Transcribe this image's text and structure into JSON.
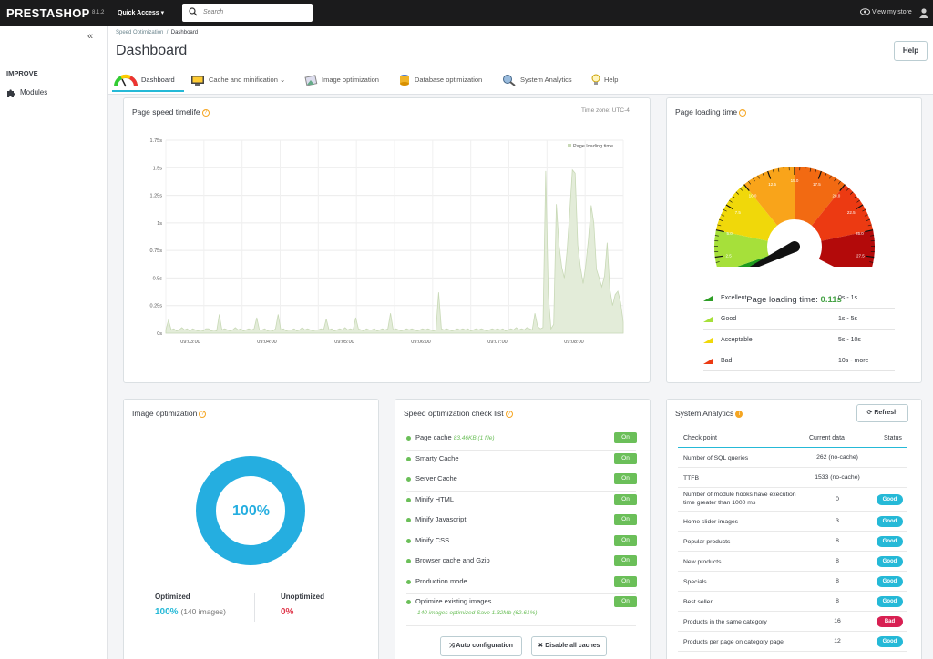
{
  "topbar": {
    "logo": "PRESTASHOP",
    "version": "8.1.2",
    "quick_access": "Quick Access ▾",
    "search_placeholder": "Search",
    "view_store": "View my store"
  },
  "sidebar": {
    "collapse": "«",
    "section": "IMPROVE",
    "modules": "Modules"
  },
  "header": {
    "breadcrumb_parent": "Speed Optimization",
    "breadcrumb_sep": "/",
    "breadcrumb_current": "Dashboard",
    "title": "Dashboard",
    "help": "Help"
  },
  "tabs": [
    {
      "label": "Dashboard",
      "icon": "gauge-icon"
    },
    {
      "label": "Cache and minification ⌄",
      "icon": "monitor-icon"
    },
    {
      "label": "Image optimization",
      "icon": "image-icon"
    },
    {
      "label": "Database optimization",
      "icon": "database-icon"
    },
    {
      "label": "System Analytics",
      "icon": "analytics-icon"
    },
    {
      "label": "Help",
      "icon": "bulb-icon"
    }
  ],
  "speed_card": {
    "title": "Page speed timelife",
    "timezone": "Time zone: UTC-4",
    "legend": "Page loading time"
  },
  "chart_data": {
    "type": "area",
    "series": [
      {
        "name": "Page loading time",
        "color": "#c8d9b6"
      }
    ],
    "x": [
      "09:03:00",
      "09:04:00",
      "09:05:00",
      "09:06:00",
      "09:07:00",
      "09:08:00"
    ],
    "ylim": [
      0,
      1.75
    ],
    "y_ticks": [
      "0s",
      "0.25s",
      "0.5s",
      "0.75s",
      "1s",
      "1.25s",
      "1.5s",
      "1.75s"
    ],
    "grid": true,
    "legend": "top-right",
    "values": [
      0.03,
      0.12,
      0.03,
      0.04,
      0.02,
      0.03,
      0.05,
      0.03,
      0.04,
      0.02,
      0.04,
      0.03,
      0.02,
      0.03,
      0.02,
      0.04,
      0.04,
      0.02,
      0.03,
      0.02,
      0.17,
      0.03,
      0.04,
      0.03,
      0.02,
      0.03,
      0.05,
      0.03,
      0.04,
      0.02,
      0.03,
      0.04,
      0.03,
      0.04,
      0.14,
      0.03,
      0.03,
      0.04,
      0.02,
      0.03,
      0.02,
      0.04,
      0.17,
      0.03,
      0.04,
      0.02,
      0.03,
      0.03,
      0.04,
      0.02,
      0.03,
      0.05,
      0.03,
      0.04,
      0.03,
      0.02,
      0.03,
      0.03,
      0.04,
      0.03,
      0.13,
      0.03,
      0.04,
      0.02,
      0.03,
      0.04,
      0.03,
      0.05,
      0.03,
      0.04,
      0.03,
      0.14,
      0.04,
      0.03,
      0.02,
      0.04,
      0.03,
      0.03,
      0.04,
      0.02,
      0.03,
      0.04,
      0.03,
      0.04,
      0.18,
      0.03,
      0.04,
      0.03,
      0.02,
      0.03,
      0.04,
      0.03,
      0.04,
      0.03,
      0.02,
      0.03,
      0.04,
      0.03,
      0.04,
      0.03,
      0.02,
      0.03,
      0.37,
      0.04,
      0.03,
      0.04,
      0.03,
      0.02,
      0.03,
      0.04,
      0.03,
      0.04,
      0.03,
      0.04,
      0.02,
      0.03,
      0.04,
      0.03,
      0.04,
      0.03,
      0.02,
      0.03,
      0.04,
      0.03,
      0.04,
      0.03,
      0.04,
      0.02,
      0.03,
      0.04,
      0.03,
      0.05,
      0.03,
      0.04,
      0.03,
      0.05,
      0.04,
      0.03,
      0.18,
      0.06,
      0.04,
      0.05,
      1.47,
      0.35,
      0.04,
      0.08,
      1.17,
      0.8,
      0.6,
      0.5,
      0.75,
      1.1,
      1.48,
      1.45,
      0.8,
      0.6,
      0.45,
      0.62,
      0.85,
      1.16,
      1.0,
      0.58,
      0.5,
      0.42,
      0.52,
      0.82,
      0.4,
      0.25,
      0.35,
      0.38,
      0.28,
      0.1
    ]
  },
  "gauge": {
    "title": "Page loading time",
    "ticks": [
      "0.0",
      "2.5",
      "5.0",
      "7.5",
      "10.0",
      "12.5",
      "15.0",
      "17.5",
      "20.0",
      "22.5",
      "25.0",
      "27.5",
      "30"
    ],
    "value": 0.11,
    "label_prefix": "Page loading time: ",
    "label_value": "0.11s",
    "legend": [
      {
        "name": "Excellent",
        "range": "0s - 1s",
        "color": "#2e9e26"
      },
      {
        "name": "Good",
        "range": "1s - 5s",
        "color": "#a6e03a"
      },
      {
        "name": "Acceptable",
        "range": "5s - 10s",
        "color": "#f0d80a"
      },
      {
        "name": "Bad",
        "range": "10s - more",
        "color": "#ec3a12"
      }
    ]
  },
  "image_opt": {
    "title": "Image optimization",
    "percent": "100%",
    "optimized_label": "Optimized",
    "optimized_value": "100%",
    "optimized_count": "(140 images)",
    "unoptimized_label": "Unoptimized",
    "unoptimized_value": "0%",
    "donut_color": "#25aee0"
  },
  "checklist": {
    "title": "Speed optimization check list",
    "items": [
      {
        "label": "Page cache",
        "note": "83.46KB (1 file)",
        "status": "On"
      },
      {
        "label": "Smarty Cache",
        "status": "On"
      },
      {
        "label": "Server Cache",
        "status": "On"
      },
      {
        "label": "Minify HTML",
        "status": "On"
      },
      {
        "label": "Minify Javascript",
        "status": "On"
      },
      {
        "label": "Minify CSS",
        "status": "On"
      },
      {
        "label": "Browser cache and Gzip",
        "status": "On"
      },
      {
        "label": "Production mode",
        "status": "On"
      },
      {
        "label": "Optimize existing images",
        "sub": "140 images optimized Save 1.32Mb (62.61%)",
        "status": "On"
      }
    ],
    "auto_btn": "Auto configuration",
    "disable_btn": "Disable all caches"
  },
  "analytics": {
    "title": "System Analytics",
    "refresh": "Refresh",
    "headers": [
      "Check point",
      "Current data",
      "Status"
    ],
    "rows": [
      {
        "check": "Number of SQL queries",
        "data": "262 (no-cache)",
        "status": ""
      },
      {
        "check": "TTFB",
        "data": "1533 (no-cache)",
        "status": ""
      },
      {
        "check": "Number of module hooks have execution time greater than 1000 ms",
        "data": "0",
        "status": "Good"
      },
      {
        "check": "Home slider images",
        "data": "3",
        "status": "Good"
      },
      {
        "check": "Popular products",
        "data": "8",
        "status": "Good"
      },
      {
        "check": "New products",
        "data": "8",
        "status": "Good"
      },
      {
        "check": "Specials",
        "data": "8",
        "status": "Good"
      },
      {
        "check": "Best seller",
        "data": "8",
        "status": "Good"
      },
      {
        "check": "Products in the same category",
        "data": "16",
        "status": "Bad"
      },
      {
        "check": "Products per page on category page",
        "data": "12",
        "status": "Good"
      }
    ]
  }
}
